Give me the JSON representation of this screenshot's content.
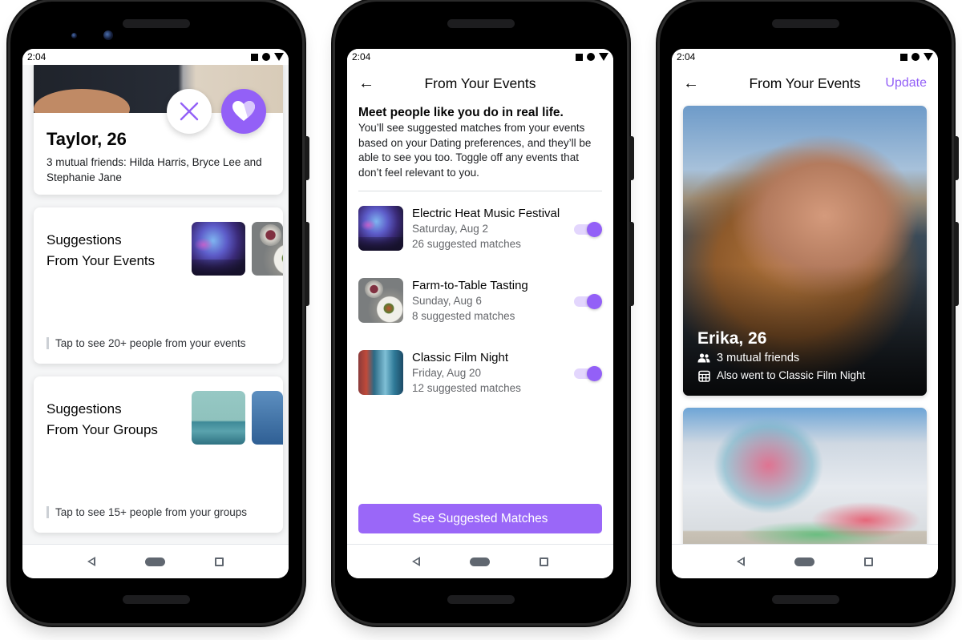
{
  "status_bar": {
    "time": "2:04"
  },
  "screen1": {
    "profile": {
      "name": "Taylor, 26",
      "mutual_friends": "3 mutual friends: Hilda Harris, Bryce Lee and Stephanie Jane",
      "pass_icon": "close-icon",
      "like_icon": "heart-icon"
    },
    "suggestion_cards": [
      {
        "title_line1": "Suggestions",
        "title_line2": "From Your Events",
        "footer": "Tap to see 20+ people from your events",
        "thumbnails": [
          "concert-image",
          "food-image"
        ]
      },
      {
        "title_line1": "Suggestions",
        "title_line2": "From Your Groups",
        "footer": "Tap to see 15+ people from your groups",
        "thumbnails": [
          "building-image",
          "blue-image"
        ]
      }
    ]
  },
  "screen2": {
    "header": {
      "back_icon": "arrow-left-icon",
      "title": "From Your Events"
    },
    "intro_title": "Meet people like you do in real life.",
    "intro_body": "You’ll see suggested matches from your events based on your Dating preferences, and they’ll be able to see you too. Toggle off any events that don’t feel relevant to you.",
    "events": [
      {
        "name": "Electric Heat Music Festival",
        "date": "Saturday, Aug 2",
        "matches": "26 suggested matches",
        "enabled": true
      },
      {
        "name": "Farm-to-Table Tasting",
        "date": "Sunday, Aug 6",
        "matches": "8 suggested matches",
        "enabled": true
      },
      {
        "name": "Classic Film Night",
        "date": "Friday, Aug 20",
        "matches": "12 suggested matches",
        "enabled": true
      }
    ],
    "cta_label": "See Suggested Matches"
  },
  "screen3": {
    "header": {
      "back_icon": "arrow-left-icon",
      "title": "From Your Events",
      "action_label": "Update"
    },
    "matches": [
      {
        "name": "Erika, 26",
        "mutual_friends": "3 mutual friends",
        "event_line": "Also went to Classic Film Night"
      }
    ]
  },
  "nav_bar": {
    "back": "back-icon",
    "home": "home-icon",
    "recents": "recents-icon"
  },
  "colors": {
    "accent": "#9360f7",
    "toggle_track": "#e3d6fd",
    "text_primary": "#050505",
    "text_secondary": "#65676b"
  }
}
